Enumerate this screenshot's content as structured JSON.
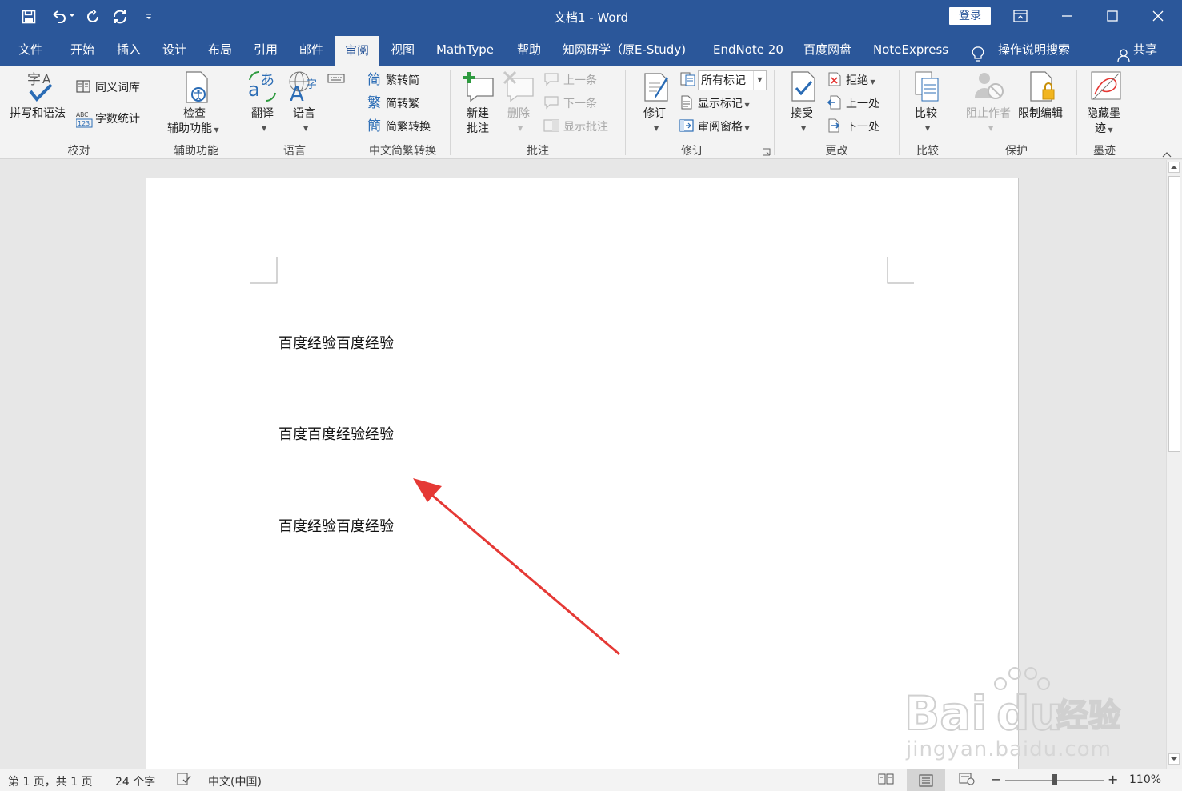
{
  "titlebar": {
    "doc_title": "文档1  -  Word",
    "login": "登录",
    "background": "#2b579a"
  },
  "tabs": [
    {
      "label": "文件"
    },
    {
      "label": "开始"
    },
    {
      "label": "插入"
    },
    {
      "label": "设计"
    },
    {
      "label": "布局"
    },
    {
      "label": "引用"
    },
    {
      "label": "邮件"
    },
    {
      "label": "审阅",
      "active": true
    },
    {
      "label": "视图"
    },
    {
      "label": "MathType"
    },
    {
      "label": "帮助"
    },
    {
      "label": "知网研学（原E-Study)"
    },
    {
      "label": "EndNote 20"
    },
    {
      "label": "百度网盘"
    },
    {
      "label": "NoteExpress"
    },
    {
      "label": "操作说明搜索"
    },
    {
      "label": "共享"
    }
  ],
  "ribbon": {
    "proofing": {
      "spell": "拼写和语法",
      "thesaurus": "同义词库",
      "wordcount": "字数统计",
      "group": "校对"
    },
    "accessibility": {
      "check_line1": "检查",
      "check_line2": "辅助功能",
      "group": "辅助功能"
    },
    "language": {
      "translate": "翻译",
      "language": "语言",
      "group": "语言"
    },
    "chinese": {
      "to_simp": "繁转简",
      "to_trad": "简转繁",
      "convert": "简繁转换",
      "group": "中文简繁转换"
    },
    "comments": {
      "new_line1": "新建",
      "new_line2": "批注",
      "delete": "删除",
      "prev": "上一条",
      "next": "下一条",
      "show": "显示批注",
      "group": "批注"
    },
    "tracking": {
      "track": "修订",
      "markup_select": "所有标记",
      "show_markup": "显示标记",
      "pane": "审阅窗格",
      "group": "修订"
    },
    "changes": {
      "accept": "接受",
      "reject": "拒绝",
      "prev": "上一处",
      "next": "下一处",
      "group": "更改"
    },
    "compare": {
      "compare": "比较",
      "group": "比较"
    },
    "protect": {
      "block": "阻止作者",
      "restrict": "限制编辑",
      "group": "保护"
    },
    "ink": {
      "hide_line1": "隐藏墨",
      "hide_line2": "迹",
      "group": "墨迹"
    }
  },
  "document": {
    "paragraphs": [
      "百度经验百度经验",
      "百度百度经验经验",
      "百度经验百度经验"
    ],
    "annotation_color": "#e53935"
  },
  "statusbar": {
    "page": "第 1 页，共 1 页",
    "words": "24 个字",
    "language": "中文(中国)",
    "zoom": "110%"
  },
  "watermark": {
    "logo": "Baidu经验",
    "url": "jingyan.baidu.com"
  }
}
